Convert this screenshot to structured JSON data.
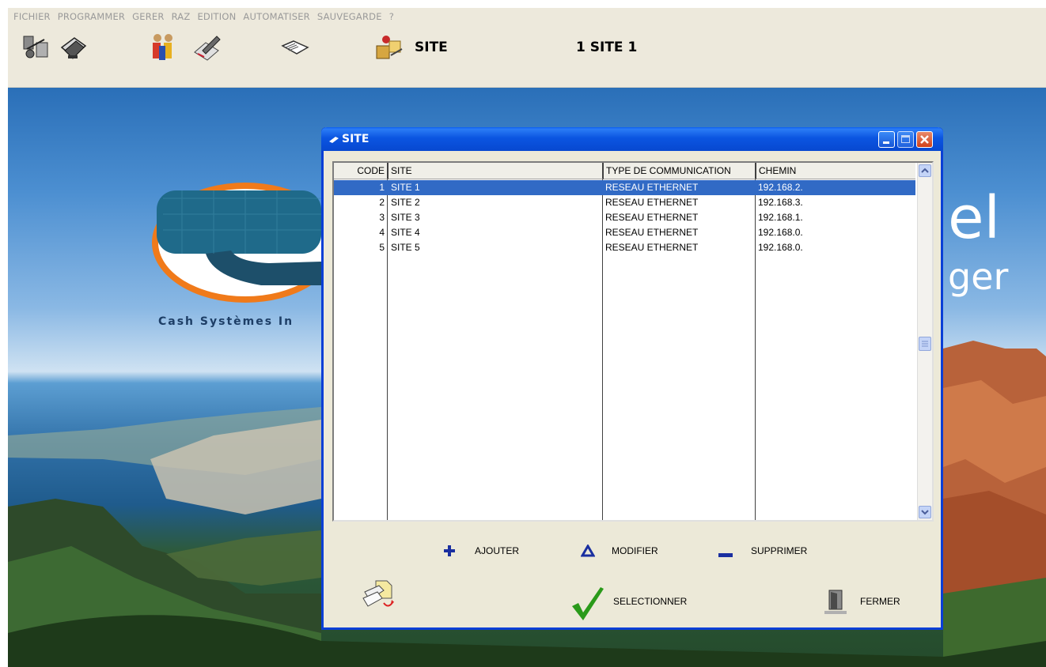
{
  "menu": [
    "FICHIER",
    "PROGRAMMER",
    "GERER",
    "RAZ",
    "EDITION",
    "AUTOMATISER",
    "SAUVEGARDE",
    "?"
  ],
  "toolbar": {
    "site_label": "SITE",
    "current_site": "1 SITE 1",
    "icons": [
      "network-config-icon",
      "printer-icon",
      "users-icon",
      "edit-pencil-icon",
      "book-icon",
      "site-icon"
    ]
  },
  "background": {
    "brand_tagline": "Cash Systèmes In",
    "brand_right_top": "el",
    "brand_right_bottom": "ger"
  },
  "dialog": {
    "title": "SITE",
    "columns": [
      "CODE",
      "SITE",
      "TYPE DE COMMUNICATION",
      "CHEMIN"
    ],
    "rows": [
      {
        "code": "1",
        "site": "SITE 1",
        "type": "RESEAU ETHERNET",
        "path": "192.168.2.",
        "selected": true
      },
      {
        "code": "2",
        "site": "SITE 2",
        "type": "RESEAU ETHERNET",
        "path": "192.168.3.",
        "selected": false
      },
      {
        "code": "3",
        "site": "SITE 3",
        "type": "RESEAU ETHERNET",
        "path": "192.168.1.",
        "selected": false
      },
      {
        "code": "4",
        "site": "SITE 4",
        "type": "RESEAU ETHERNET",
        "path": "192.168.0.",
        "selected": false
      },
      {
        "code": "5",
        "site": "SITE 5",
        "type": "RESEAU ETHERNET",
        "path": "192.168.0.",
        "selected": false
      }
    ],
    "actions": {
      "add": "AJOUTER",
      "modify": "MODIFIER",
      "delete": "SUPPRIMER",
      "select": "SELECTIONNER",
      "close": "FERMER"
    }
  },
  "colors": {
    "selection": "#316ac5",
    "titlebar": "#0b55e1",
    "add_icon": "#1a2fa0",
    "select_check": "#2a9a1a"
  }
}
